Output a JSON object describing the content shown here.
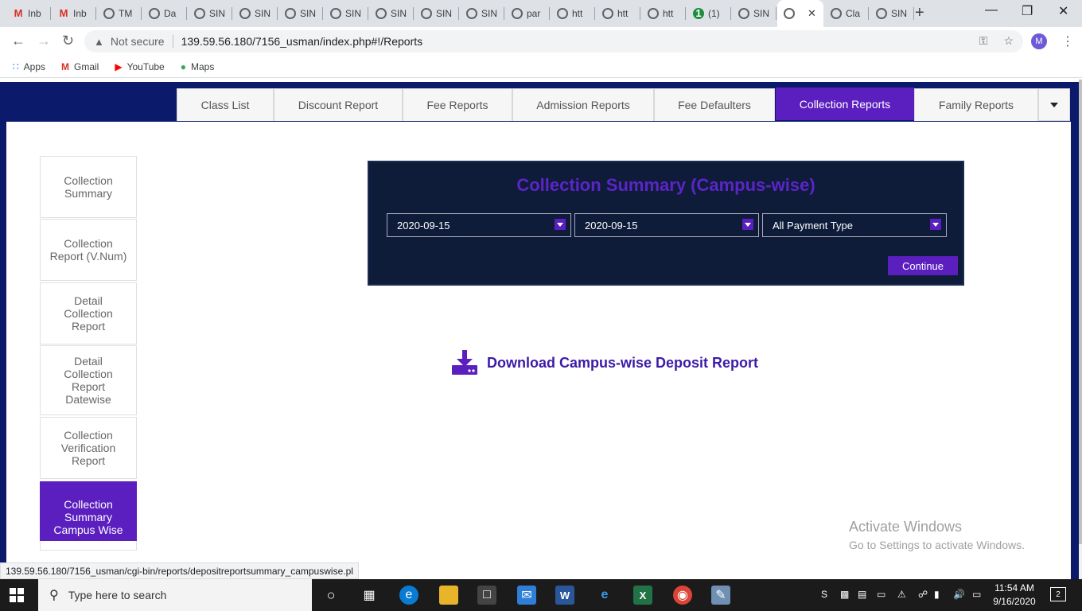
{
  "browser": {
    "tabs": [
      {
        "label": "Inb",
        "icon": "gmail"
      },
      {
        "label": "Inb",
        "icon": "gmail"
      },
      {
        "label": "TM",
        "icon": "globe"
      },
      {
        "label": "Da",
        "icon": "globe"
      },
      {
        "label": "SIN",
        "icon": "globe"
      },
      {
        "label": "SIN",
        "icon": "globe"
      },
      {
        "label": "SIN",
        "icon": "globe"
      },
      {
        "label": "SIN",
        "icon": "globe"
      },
      {
        "label": "SIN",
        "icon": "globe"
      },
      {
        "label": "SIN",
        "icon": "globe"
      },
      {
        "label": "SIN",
        "icon": "globe"
      },
      {
        "label": "par",
        "icon": "globe"
      },
      {
        "label": "htt",
        "icon": "globe"
      },
      {
        "label": "htt",
        "icon": "globe"
      },
      {
        "label": "htt",
        "icon": "globe"
      },
      {
        "label": "(1)",
        "icon": "green-badge"
      },
      {
        "label": "SIN",
        "icon": "globe"
      },
      {
        "label": "",
        "icon": "globe",
        "active": true
      },
      {
        "label": "Cla",
        "icon": "globe"
      },
      {
        "label": "SIN",
        "icon": "globe"
      }
    ],
    "security_label": "Not secure",
    "url": "139.59.56.180/7156_usman/index.php#!/Reports",
    "profile_initial": "M",
    "bookmarks": [
      {
        "label": "Apps",
        "icon": "apps-grid-icon"
      },
      {
        "label": "Gmail",
        "icon": "gmail-icon"
      },
      {
        "label": "YouTube",
        "icon": "youtube-icon"
      },
      {
        "label": "Maps",
        "icon": "maps-pin-icon"
      }
    ],
    "status_url": "139.59.56.180/7156_usman/cgi-bin/reports/depositreportsummary_campuswise.pl"
  },
  "report_tabs": [
    {
      "label": "Class List"
    },
    {
      "label": "Discount Report"
    },
    {
      "label": "Fee Reports"
    },
    {
      "label": "Admission Reports"
    },
    {
      "label": "Fee Defaulters"
    },
    {
      "label": "Collection Reports",
      "active": true
    },
    {
      "label": "Family Reports"
    }
  ],
  "side_menu": [
    {
      "label": "Collection Summary"
    },
    {
      "label": "Collection Report (V.Num)"
    },
    {
      "label": "Detail Collection Report"
    },
    {
      "label": "Detail Collection Report Datewise"
    },
    {
      "label": "Collection Verification Report"
    },
    {
      "label": "Collection Summary Campus Wise",
      "active": true
    }
  ],
  "form": {
    "title": "Collection Summary (Campus-wise)",
    "from_date": "2020-09-15",
    "to_date": "2020-09-15",
    "payment_type": "All Payment Type",
    "continue_label": "Continue"
  },
  "download": {
    "label": "Download Campus-wise Deposit Report"
  },
  "watermark": {
    "line1": "Activate Windows",
    "line2": "Go to Settings to activate Windows."
  },
  "taskbar": {
    "search_placeholder": "Type here to search",
    "time": "11:54 AM",
    "date": "9/16/2020",
    "notifications": "2"
  },
  "colors": {
    "header_navy": "#0b1a6b",
    "accent_purple": "#5b1fbf",
    "panel_bg": "#0e1c3a"
  }
}
